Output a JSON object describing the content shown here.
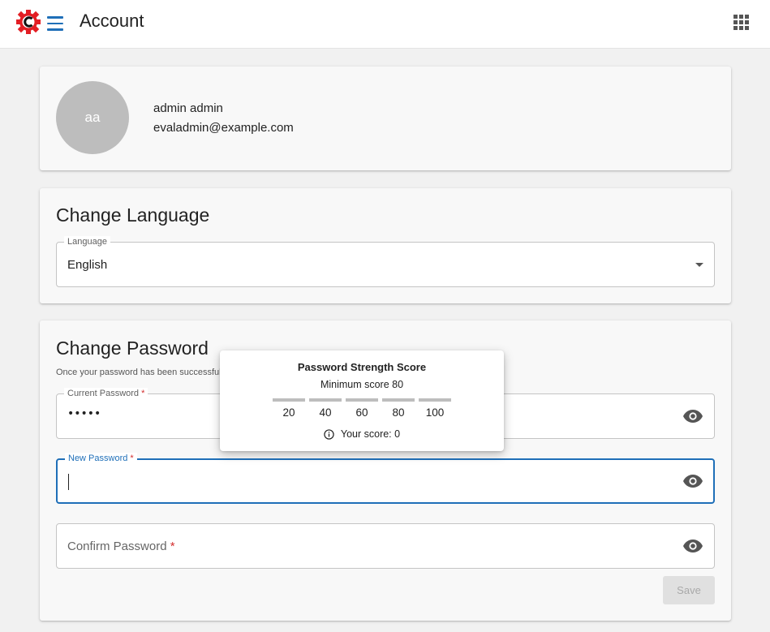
{
  "header": {
    "title": "Account",
    "logo_icon": "gear-c-logo-icon",
    "menu_icon": "hamburger-menu-icon",
    "apps_icon": "apps-grid-icon",
    "accent_color": "#1f6fb8",
    "brand_color": "#e31e24"
  },
  "profile": {
    "initials": "aa",
    "name": "admin admin",
    "email": "evaladmin@example.com"
  },
  "language": {
    "title": "Change Language",
    "field_label": "Language",
    "value": "English"
  },
  "password": {
    "title": "Change Password",
    "helper": "Once your password has been successful",
    "current": {
      "label": "Current Password",
      "required_mark": "*",
      "value": "•••••"
    },
    "new": {
      "label": "New Password",
      "required_mark": "*",
      "value": ""
    },
    "confirm": {
      "label": "Confirm Password",
      "required_mark": "*",
      "value": ""
    },
    "save_label": "Save"
  },
  "strength_popover": {
    "title": "Password Strength Score",
    "minimum": "Minimum score 80",
    "scale": [
      "20",
      "40",
      "60",
      "80",
      "100"
    ],
    "your_score": "Your score: 0"
  }
}
